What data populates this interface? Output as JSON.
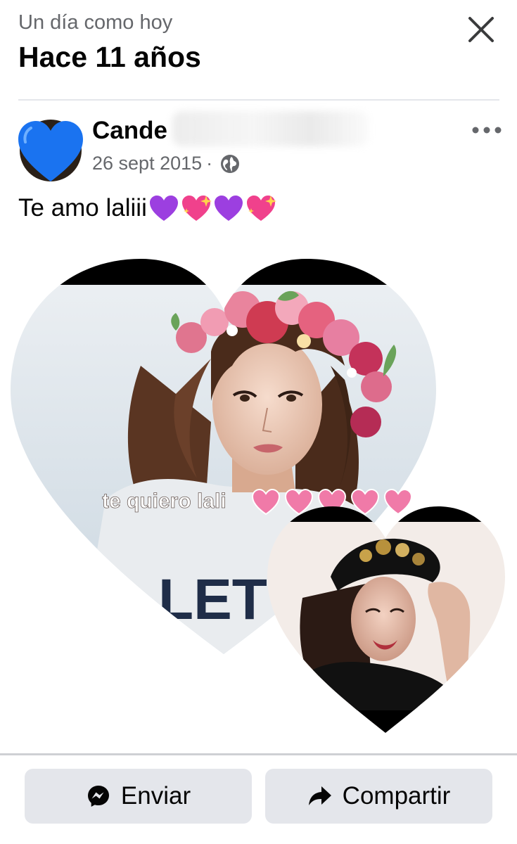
{
  "header": {
    "subtitle": "Un día como hoy",
    "title": "Hace 11 años",
    "close_icon": "close-icon"
  },
  "post": {
    "author_name": "Cande",
    "date": "26 sept 2015",
    "separator": "·",
    "audience_icon": "globe-icon",
    "text": "Te amo laliii",
    "emojis": [
      "purple-heart",
      "sparkling-heart",
      "purple-heart",
      "sparkling-heart"
    ],
    "photo": {
      "overlay_text": "te quiero lali",
      "shirt_text": "LET",
      "overlay_emojis": [
        "sparkling-heart",
        "sparkling-heart",
        "sparkling-heart",
        "sparkling-heart",
        "sparkling-heart"
      ]
    }
  },
  "actions": {
    "send_label": "Enviar",
    "share_label": "Compartir"
  },
  "colors": {
    "accent": "#1877f2",
    "secondary_text": "#65676b",
    "button_bg": "#e4e6eb"
  }
}
